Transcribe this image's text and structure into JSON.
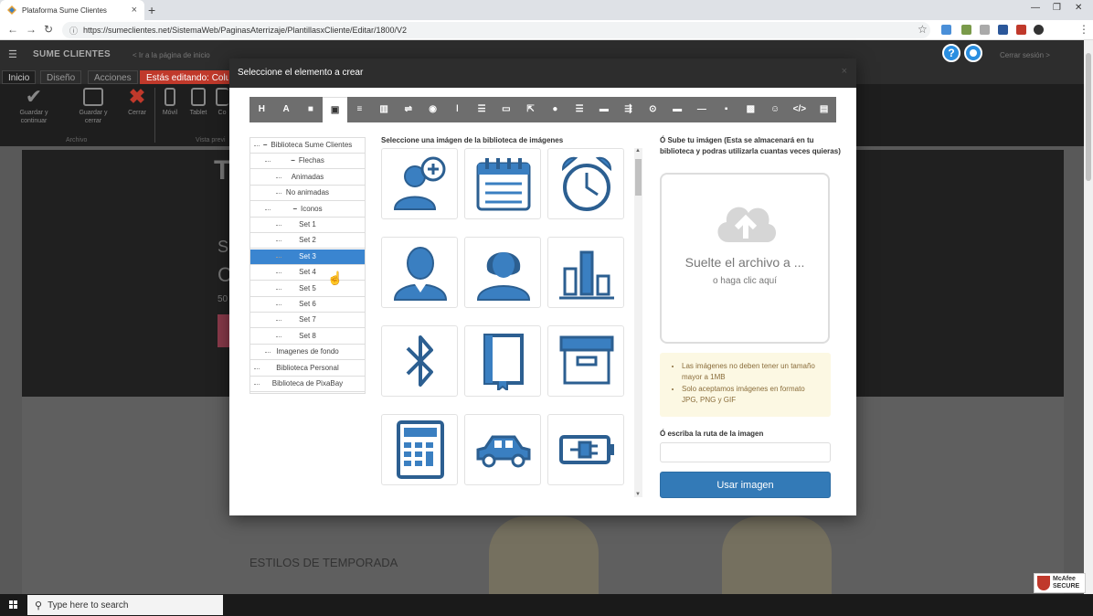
{
  "browser": {
    "tab_title": "Plataforma Sume Clientes",
    "url": "https://sumeclientes.net/SistemaWeb/PaginasAterrizaje/PlantillasxCliente/Editar/1800/V2"
  },
  "app": {
    "brand": "SUME CLIENTES",
    "back_link": "< Ir a la página de inicio",
    "logout": "Cerrar sesión >",
    "help_label": "?",
    "tabs": [
      "Inicio",
      "Diseño",
      "Acciones"
    ],
    "editing_badge": "Estás editando: Colum",
    "ribbon": {
      "save_continue": "Guardar y continuar",
      "save_close": "Guardar y cerrar",
      "close": "Cerrar",
      "mobile": "Móvil",
      "tablet": "Tablet",
      "desktop": "Co",
      "group_file": "Archivo",
      "group_preview": "Vista previ"
    }
  },
  "page": {
    "hero_title": "T",
    "hero_s": "S",
    "hero_c": "C",
    "hero_n": "50",
    "section_title": "ESTILOS DE TEMPORADA"
  },
  "modal": {
    "title": "Seleccione el elemento a crear",
    "close": "×",
    "toolbar": [
      "H",
      "A",
      "■",
      "▣",
      "≡",
      "▥",
      "⇌",
      "◉",
      "ǀ",
      "☰",
      "▭",
      "⇱",
      "●",
      "☰",
      "▬",
      "⇶",
      "⊙",
      "▬",
      "—",
      "▪",
      "▩",
      "☺",
      "</>",
      "▤"
    ],
    "tree": [
      {
        "label": "Biblioteca Sume Clientes",
        "level": 0,
        "toggle": "−"
      },
      {
        "label": "Flechas",
        "level": 1,
        "toggle": "−"
      },
      {
        "label": "Animadas",
        "level": 2
      },
      {
        "label": "No animadas",
        "level": 2
      },
      {
        "label": "Iconos",
        "level": 1,
        "toggle": "−"
      },
      {
        "label": "Set 1",
        "level": 2
      },
      {
        "label": "Set 2",
        "level": 2
      },
      {
        "label": "Set 3",
        "level": 2,
        "selected": true
      },
      {
        "label": "Set 4",
        "level": 2
      },
      {
        "label": "Set 5",
        "level": 2
      },
      {
        "label": "Set 6",
        "level": 2
      },
      {
        "label": "Set 7",
        "level": 2
      },
      {
        "label": "Set 8",
        "level": 2
      },
      {
        "label": "Imagenes de fondo",
        "level": 1
      },
      {
        "label": "Biblioteca Personal",
        "level": 0
      },
      {
        "label": "Biblioteca de PixaBay",
        "level": 0
      }
    ],
    "gallery_title": "Seleccione una imágen de la biblioteca de imágenes",
    "gallery_icons": [
      "add-user-icon",
      "calendar-icon",
      "alarm-clock-icon",
      "male-user-icon",
      "female-user-icon",
      "bar-chart-icon",
      "bluetooth-icon",
      "book-icon",
      "archive-box-icon",
      "calculator-icon",
      "car-icon",
      "battery-plug-icon"
    ],
    "upload_title": "Ó Sube tu imágen (Esta se almacenará en tu biblioteca y podras utilizarla cuantas veces quieras)",
    "drop_main": "Suelte el archivo a ...",
    "drop_sub": "o haga clic aquí",
    "notice": [
      "Las imágenes no deben tener un tamaño mayor a 1MB",
      "Solo aceptamos imágenes en formato JPG, PNG y GIF"
    ],
    "path_label": "Ó escriba la ruta de la imagen",
    "path_value": "",
    "use_button": "Usar imagen"
  },
  "mcafee": {
    "line1": "McAfee",
    "line2": "SECURE"
  },
  "taskbar": {
    "search_placeholder": "Type here to search"
  },
  "colors": {
    "icon_blue": "#3a7fc1",
    "selected": "#3a85d0",
    "accent_red": "#c0392b"
  }
}
